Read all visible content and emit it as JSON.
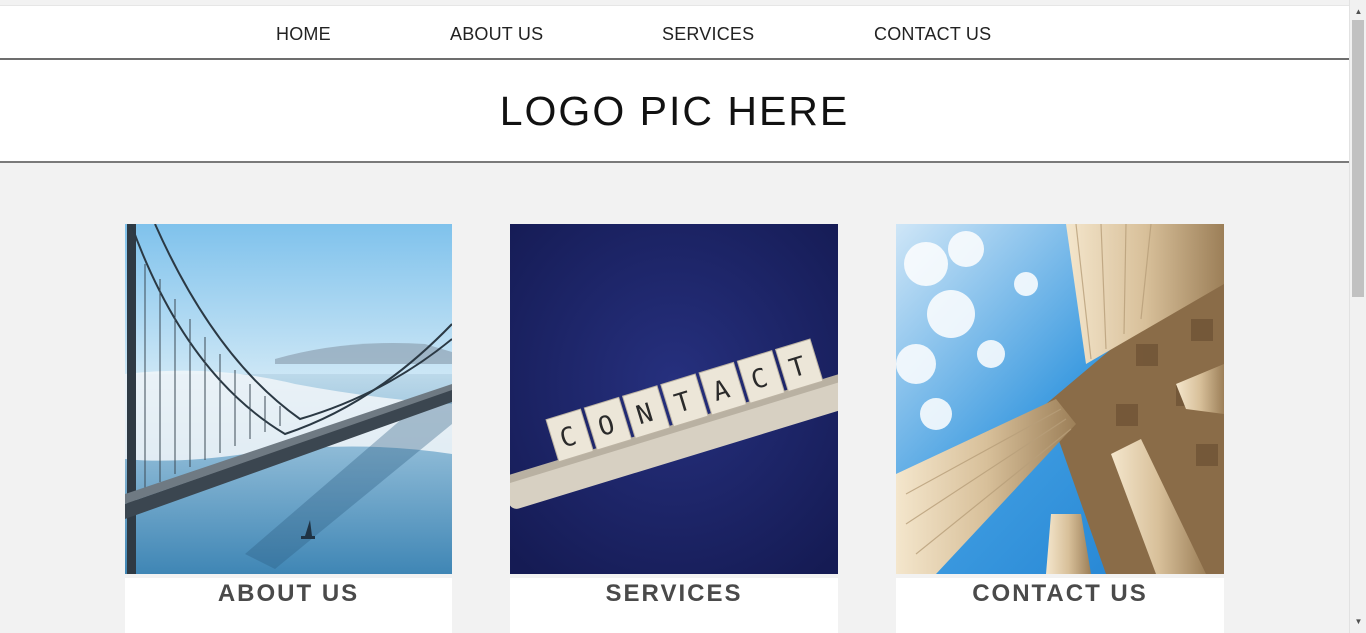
{
  "nav": {
    "items": [
      {
        "label": "HOME"
      },
      {
        "label": "ABOUT US"
      },
      {
        "label": "SERVICES"
      },
      {
        "label": "CONTACT US"
      }
    ]
  },
  "header": {
    "logo_text": "LOGO PIC HERE"
  },
  "cards": [
    {
      "title": "ABOUT US",
      "image": "golden-gate-bridge-photo"
    },
    {
      "title": "SERVICES",
      "image": "scrabble-contact-tiles-photo",
      "tiles": [
        "C",
        "O",
        "N",
        "T",
        "A",
        "C",
        "T"
      ]
    },
    {
      "title": "CONTACT US",
      "image": "classical-columns-sky-photo"
    }
  ],
  "colors": {
    "background": "#f2f2f2",
    "header_border": "#6d6d6d",
    "card_title": "#4a4a4a",
    "navy": "#1b2266"
  }
}
